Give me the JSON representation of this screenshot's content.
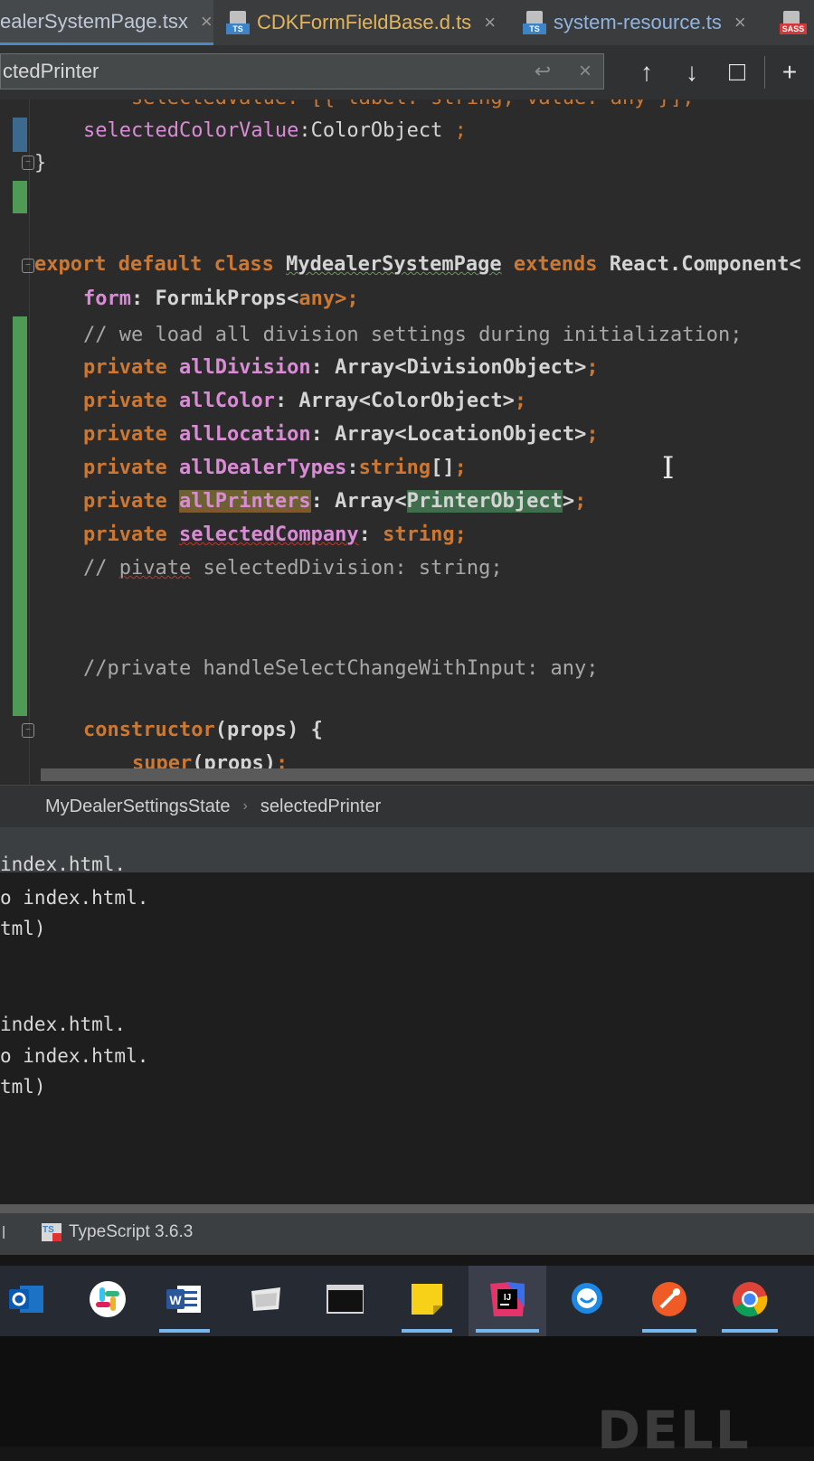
{
  "tabs": [
    {
      "label": "ealerSystemPage.tsx",
      "active": true
    },
    {
      "label": "CDKFormFieldBase.d.ts",
      "active": false,
      "badge": "TS"
    },
    {
      "label": "system-resource.ts",
      "active": false,
      "badge": "TS"
    },
    {
      "label": "",
      "active": false,
      "badge": "SASS"
    }
  ],
  "find": {
    "query": "ctedPrinter",
    "close_glyph": "×",
    "wrap_glyph": "↩",
    "prev_glyph": "↑",
    "next_glyph": "↓",
    "window_glyph": "□",
    "add_glyph": "+"
  },
  "code": {
    "l0": "    selectedValue: [{ label: string; value: any }];",
    "l1_field": "selectedColorValue",
    "l1_type": ":ColorObject ",
    "l1_end": ";",
    "l2": "}",
    "l3_kw1": "export default class ",
    "l3_name": "MydealerSystemPage",
    "l3_kw2": " extends ",
    "l3_base": "React.Component<",
    "l4_field": "form",
    "l4_rest": ": FormikProps<",
    "l4_any": "any",
    "l4_end": ">;",
    "l5": "// we load all division settings during initialization;",
    "l6": [
      "private ",
      "allDivision",
      ": Array<DivisionObject>",
      ";"
    ],
    "l7": [
      "private ",
      "allColor",
      ": Array<ColorObject>",
      ";"
    ],
    "l8": [
      "private ",
      "allLocation",
      ": Array<LocationObject>",
      ";"
    ],
    "l9": [
      "private ",
      "allDealerTypes",
      ":",
      "string",
      "[]",
      ";"
    ],
    "l10": [
      "private ",
      "allPrinters",
      ": Array<",
      "PrinterObject",
      ">",
      ";"
    ],
    "l11": [
      "private ",
      "selectedCompany",
      ": ",
      "string;"
    ],
    "l12_a": "// ",
    "l12_b": "pivate",
    "l12_c": " selectedDivision: string;",
    "l13": "//private handleSelectChangeWithInput: any;",
    "l14_kw": "constructor",
    "l14_rest": "(props) {",
    "l15_kw": "super",
    "l15_rest": "(props)",
    "l15_end": ";"
  },
  "breadcrumb": {
    "items": [
      "MyDealerSettingsState",
      "selectedPrinter"
    ],
    "separator": "›"
  },
  "terminal": {
    "lines": [
      "index.html.",
      "o index.html.",
      "tml)",
      "",
      "",
      "index.html.",
      "o index.html.",
      "tml)"
    ]
  },
  "statusbar": {
    "left_char": "l",
    "language_badge": "TS",
    "language": "TypeScript 3.6.3"
  },
  "taskbar": {
    "apps": [
      {
        "name": "outlook-icon",
        "running": false
      },
      {
        "name": "slack-icon",
        "running": false
      },
      {
        "name": "word-icon",
        "running": true
      },
      {
        "name": "file-explorer-icon",
        "running": false
      },
      {
        "name": "terminal-icon",
        "running": false
      },
      {
        "name": "sticky-notes-icon",
        "running": true
      },
      {
        "name": "intellij-icon",
        "running": true
      },
      {
        "name": "chat-icon",
        "running": false
      },
      {
        "name": "postman-icon",
        "running": true
      },
      {
        "name": "chrome-icon",
        "running": true
      }
    ]
  },
  "bezel": {
    "logo": "DELL"
  },
  "colors": {
    "keyword": "#cc7832",
    "field": "#d98bd6",
    "editor_bg": "#2b2b2b",
    "accent": "#4a88c7",
    "change_marker": "#4f9a54"
  }
}
